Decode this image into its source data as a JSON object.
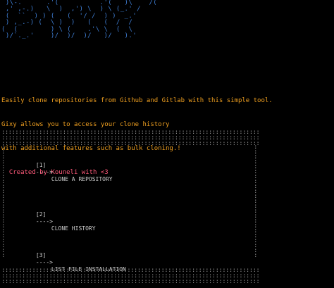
{
  "ascii_art": " )\\-.      .'(          .'(   )\\    /(\n ,' ,-.)   \\  )  ,') \\  ) \\ (_.' /\n (  ``  ) ) (   (  '/ /  ) )  _.'\n ) ,_.-) (  \\ )  )   (   (  /  /\n(  (        ) \\ (    .'\\ \\  (  \\\n )/`._.'    )/  )/  )/   )/   ).'",
  "intro": {
    "line1": "Easily clone repositories from Github and Gitlab with this simple tool.",
    "line2": "Gixy allows you to access your clone history",
    "line3": "with additional features such as bulk cloning.!",
    "credit": "  Created by Kouneli with <3"
  },
  "menu": {
    "border_pattern": "::::::::::::::::::::::::::::::::::::::::::::::::::::::::::::::::::::::::::::",
    "side_pattern": ":\n:\n:\n:\n:\n:\n:\n:\n:\n:\n:\n:\n:\n:\n:\n:\n:\n:\n:\n:\n:\n:\n:",
    "items": [
      {
        "num": "[1]",
        "arrow": "---->",
        "label": "CLONE A REPOSITORY"
      },
      {
        "num": "[2]",
        "arrow": "---->",
        "label": "CLONE HISTORY"
      },
      {
        "num": "[3]",
        "arrow": "---->",
        "label": "LIST FILE INSTALLATION"
      }
    ]
  },
  "colors": {
    "background": "#000000",
    "ascii": "#3f7fd6",
    "intro": "#f0a020",
    "credit": "#ff5a7a",
    "border": "#8a8a8a",
    "menu_text": "#cfcfcf"
  }
}
